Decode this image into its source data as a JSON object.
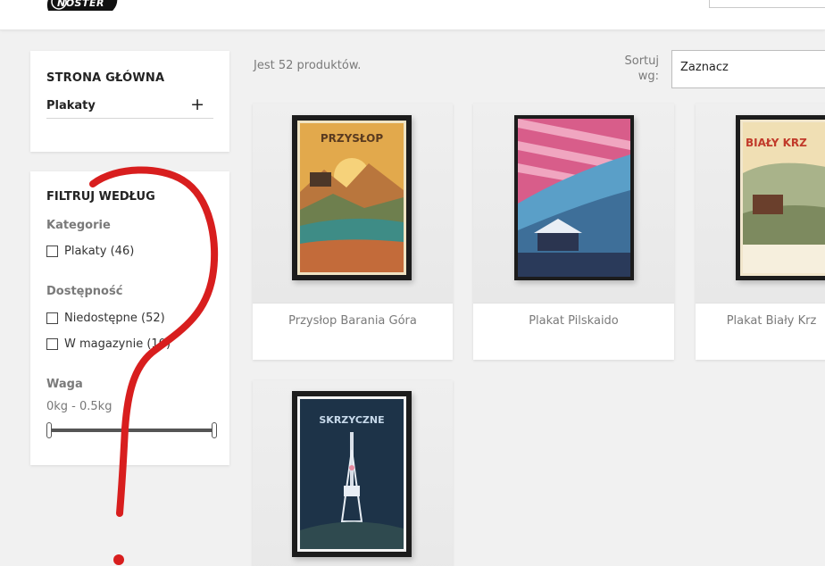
{
  "header": {
    "logo_text": "NOSTER"
  },
  "sidebar": {
    "home_label": "STRONA GŁÓWNA",
    "category_label": "Plakaty",
    "expand_icon": "plus-icon",
    "filter_title": "FILTRUJ WEDŁUG",
    "facets": {
      "categories_title": "Kategorie",
      "categories_options": [
        "Plakaty (46)"
      ],
      "availability_title": "Dostępność",
      "availability_options": [
        "Niedostępne (52)",
        "W magazynie (10)"
      ],
      "weight_title": "Waga",
      "weight_range": "0kg - 0.5kg"
    }
  },
  "listing": {
    "count_text": "Jest 52 produktów.",
    "sort_label": "Sortuj wg:",
    "sort_value": "Zaznacz"
  },
  "products": [
    {
      "name": "Przysłop Barania Góra",
      "poster_title": "PRZYSŁOP"
    },
    {
      "name": "Plakat Pilskaido"
    },
    {
      "name": "Plakat Biały Krz",
      "poster_title": "BIAŁY KRZ"
    },
    {
      "name": "",
      "poster_title": "SKRZYCZNE"
    }
  ],
  "colors": {
    "annotation_red": "#d81e1e",
    "accent_dark": "#232323"
  }
}
